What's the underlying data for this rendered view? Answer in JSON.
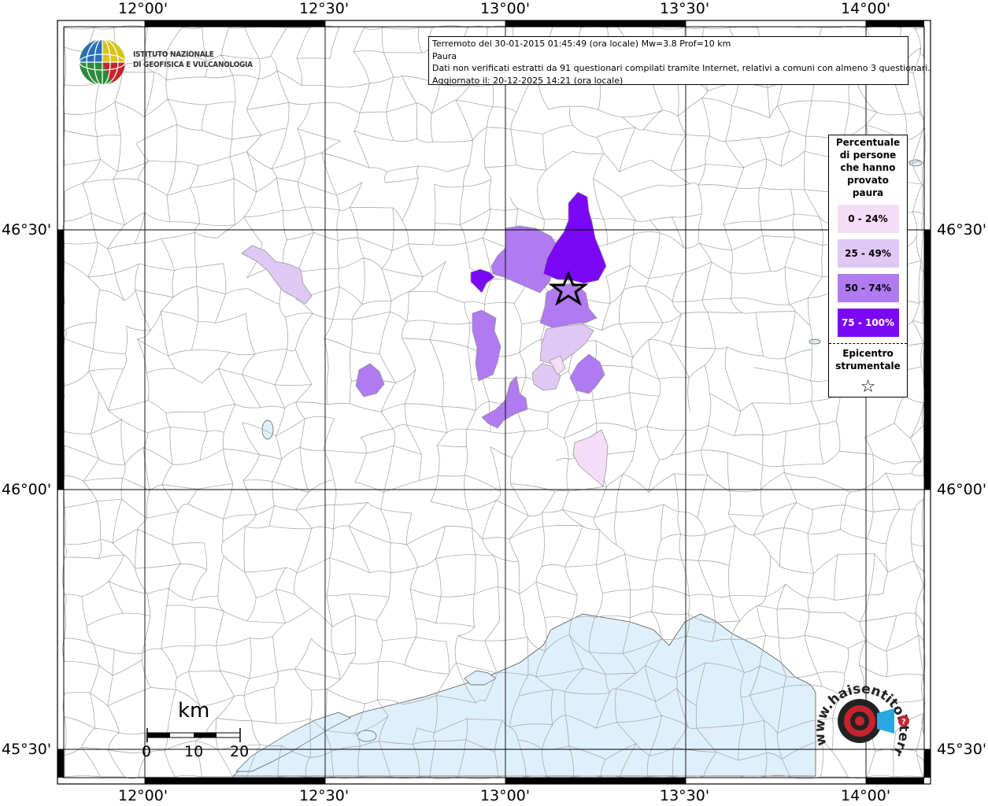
{
  "header": {
    "line1": "Terremoto del 30-01-2015 01:45:49 (ora locale) Mw=3.8 Prof=10 km",
    "line2": "Paura",
    "line3": "Dati non verificati estratti da 91 questionari compilati tramite Internet, relativi a comuni con almeno 3 questionari.",
    "line4": "Aggiornato il: 20-12-2025 14:21 (ora locale)"
  },
  "institute": {
    "line1": "ISTITUTO NAZIONALE",
    "line2": "DI GEOFISICA E VULCANOLOGIA"
  },
  "axes": {
    "top": [
      "12°00'",
      "12°30'",
      "13°00'",
      "13°30'",
      "14°00'"
    ],
    "bottom": [
      "12°00'",
      "12°30'",
      "13°00'",
      "13°30'",
      "14°00'"
    ],
    "left": [
      "46°30'",
      "46°00'",
      "45°30'"
    ],
    "right": [
      "46°30'",
      "46°00'",
      "45°30'"
    ]
  },
  "legend": {
    "title_lines": [
      "Percentuale",
      "di persone",
      "che hanno",
      "provato",
      "paura"
    ],
    "classes": [
      {
        "label": "0 - 24%",
        "color": "#f5dcf7"
      },
      {
        "label": "25 - 49%",
        "color": "#e0c8f4"
      },
      {
        "label": "50 - 74%",
        "color": "#b07af0"
      },
      {
        "label": "75 - 100%",
        "color": "#7b08f4"
      }
    ],
    "epicenter_lines": [
      "Epicentro",
      "strumentale"
    ],
    "epicenter_symbol": "☆"
  },
  "scale": {
    "unit": "km",
    "ticks": [
      "0",
      "10",
      "20"
    ]
  },
  "colors": {
    "sea": "#def0fc",
    "border": "#aaaaaa",
    "class_0": "#f5dcf7",
    "class_1": "#e0c8f4",
    "class_2": "#b07af0",
    "class_3": "#7b08f4"
  },
  "logo": {
    "text": "www.haisentitoilterremoto.it"
  }
}
